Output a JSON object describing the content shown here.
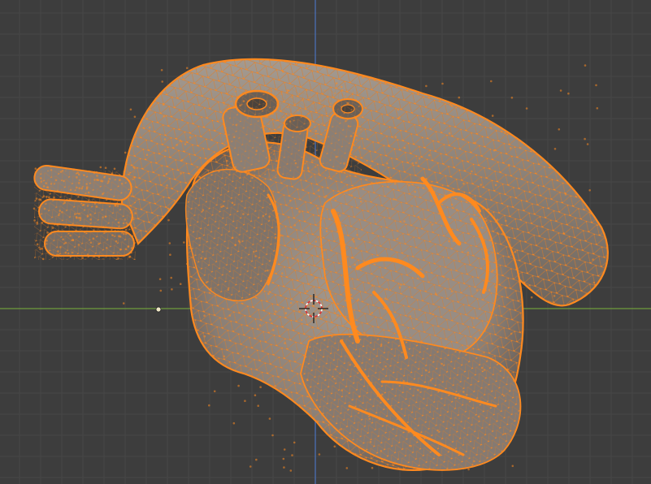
{
  "viewport": {
    "view": "3d-viewport",
    "mode": "edit-mode",
    "object": "heart-mesh",
    "selection": "all-vertices-selected",
    "shading": "solid"
  },
  "colors": {
    "background": "#3d3d3d",
    "grid_minor": "#474747",
    "grid_major": "#4f4f4f",
    "x_axis": "#6f9b3c",
    "y_axis": "#4a6fb5",
    "mesh_fill": "#8a7f76",
    "mesh_shadow": "#5f5650",
    "mesh_highlight": "#a49a90",
    "wire": "#e07b22",
    "vertex": "#ff8a1f"
  },
  "icons": [
    "3d-cursor-icon",
    "object-origin-icon"
  ]
}
